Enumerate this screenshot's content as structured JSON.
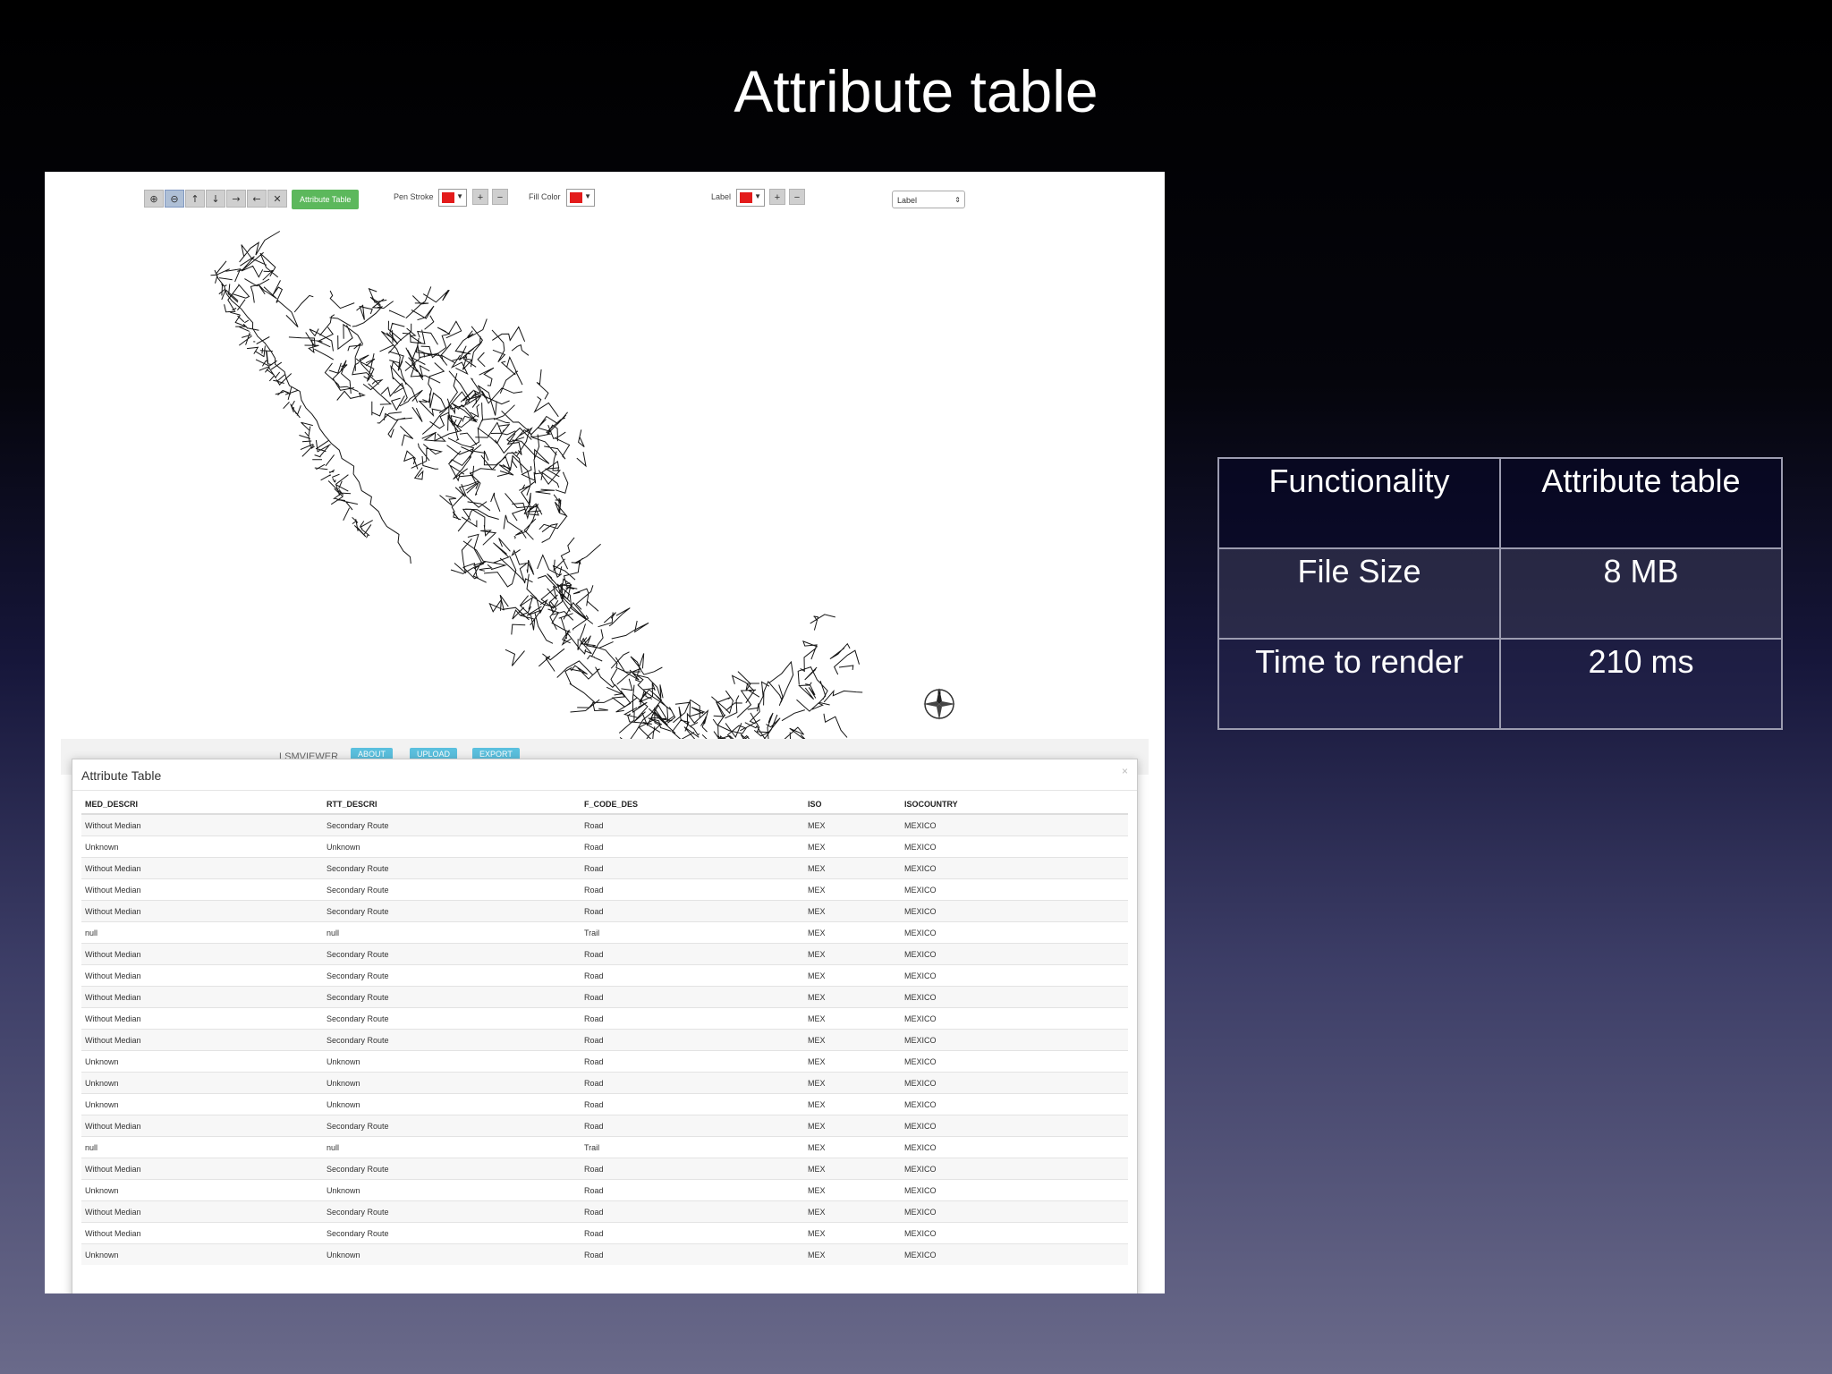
{
  "slide": {
    "title": "Attribute table"
  },
  "toolbar": {
    "attribute_table_label": "Attribute Table",
    "pen_stroke_label": "Pen Stroke",
    "fill_color_label": "Fill Color",
    "label_label": "Label",
    "label_select_value": "Label",
    "stroke_color": "#e31b1b",
    "fill_color": "#e31b1b",
    "label_color": "#e31b1b"
  },
  "navbar": {
    "brand": "LSMVIEWER",
    "about": "ABOUT",
    "upload": "UPLOAD",
    "export": "EXPORT"
  },
  "modal": {
    "title": "Attribute Table",
    "close": "×",
    "columns": [
      "MED_DESCRI",
      "RTT_DESCRI",
      "F_CODE_DES",
      "ISO",
      "ISOCOUNTRY"
    ],
    "rows": [
      [
        "Without Median",
        "Secondary Route",
        "Road",
        "MEX",
        "MEXICO"
      ],
      [
        "Unknown",
        "Unknown",
        "Road",
        "MEX",
        "MEXICO"
      ],
      [
        "Without Median",
        "Secondary Route",
        "Road",
        "MEX",
        "MEXICO"
      ],
      [
        "Without Median",
        "Secondary Route",
        "Road",
        "MEX",
        "MEXICO"
      ],
      [
        "Without Median",
        "Secondary Route",
        "Road",
        "MEX",
        "MEXICO"
      ],
      [
        "null",
        "null",
        "Trail",
        "MEX",
        "MEXICO"
      ],
      [
        "Without Median",
        "Secondary Route",
        "Road",
        "MEX",
        "MEXICO"
      ],
      [
        "Without Median",
        "Secondary Route",
        "Road",
        "MEX",
        "MEXICO"
      ],
      [
        "Without Median",
        "Secondary Route",
        "Road",
        "MEX",
        "MEXICO"
      ],
      [
        "Without Median",
        "Secondary Route",
        "Road",
        "MEX",
        "MEXICO"
      ],
      [
        "Without Median",
        "Secondary Route",
        "Road",
        "MEX",
        "MEXICO"
      ],
      [
        "Unknown",
        "Unknown",
        "Road",
        "MEX",
        "MEXICO"
      ],
      [
        "Unknown",
        "Unknown",
        "Road",
        "MEX",
        "MEXICO"
      ],
      [
        "Unknown",
        "Unknown",
        "Road",
        "MEX",
        "MEXICO"
      ],
      [
        "Without Median",
        "Secondary Route",
        "Road",
        "MEX",
        "MEXICO"
      ],
      [
        "null",
        "null",
        "Trail",
        "MEX",
        "MEXICO"
      ],
      [
        "Without Median",
        "Secondary Route",
        "Road",
        "MEX",
        "MEXICO"
      ],
      [
        "Unknown",
        "Unknown",
        "Road",
        "MEX",
        "MEXICO"
      ],
      [
        "Without Median",
        "Secondary Route",
        "Road",
        "MEX",
        "MEXICO"
      ],
      [
        "Without Median",
        "Secondary Route",
        "Road",
        "MEX",
        "MEXICO"
      ],
      [
        "Unknown",
        "Unknown",
        "Road",
        "MEX",
        "MEXICO"
      ]
    ]
  },
  "comparison": {
    "rows": [
      [
        "Functionality",
        "Attribute table"
      ],
      [
        "File Size",
        "8 MB"
      ],
      [
        "Time to render",
        "210 ms"
      ]
    ]
  },
  "icons": {
    "toolbar": [
      "zoom-in-icon",
      "zoom-out-icon",
      "pan-up-icon",
      "pan-down-icon",
      "pan-right-icon",
      "pan-left-icon",
      "full-extent-icon"
    ],
    "map": "north-arrow-icon"
  }
}
